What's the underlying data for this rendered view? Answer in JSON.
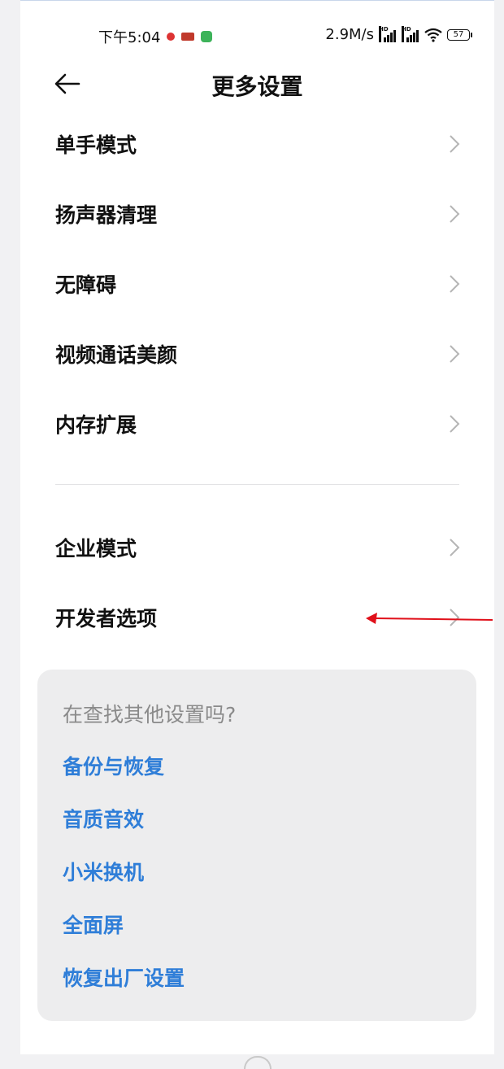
{
  "status_bar": {
    "time": "下午5:04",
    "network_speed": "2.9M/s",
    "hd_label_1": "HD",
    "hd_label_2": "HD",
    "battery": "57"
  },
  "header": {
    "title": "更多设置"
  },
  "settings_group_1": [
    {
      "label": "单手模式"
    },
    {
      "label": "扬声器清理"
    },
    {
      "label": "无障碍"
    },
    {
      "label": "视频通话美颜"
    },
    {
      "label": "内存扩展"
    }
  ],
  "settings_group_2": [
    {
      "label": "企业模式"
    },
    {
      "label": "开发者选项"
    }
  ],
  "suggestions": {
    "title": "在查找其他设置吗?",
    "links": [
      {
        "label": "备份与恢复"
      },
      {
        "label": "音质音效"
      },
      {
        "label": "小米换机"
      },
      {
        "label": "全面屏"
      },
      {
        "label": "恢复出厂设置"
      }
    ]
  },
  "colors": {
    "link": "#2f7ed8",
    "annotation_arrow": "#e0101a",
    "card_bg": "#ededee"
  }
}
